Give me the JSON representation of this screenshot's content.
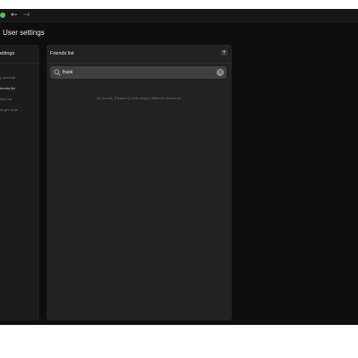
{
  "window": {
    "back_icon": "arrow-left-icon",
    "forward_icon": "arrow-right-icon",
    "status_color": "#58c05a"
  },
  "page": {
    "title": "User settings"
  },
  "sidebar": {
    "header": "ettings",
    "items": [
      {
        "label": "y account",
        "active": false
      },
      {
        "label": "riends list",
        "active": true
      },
      {
        "label": "lock list",
        "active": false
      },
      {
        "label": "anger zone",
        "active": false
      }
    ]
  },
  "panel": {
    "title": "Friends list",
    "add_icon": "plus-icon",
    "search": {
      "value": "frank",
      "search_icon": "search-icon",
      "clear_icon": "close-icon"
    },
    "empty_message": "No results. Please try searching a different username."
  },
  "colors": {
    "app_background": "#0e0e0e",
    "panel_background": "#222222",
    "search_background": "#404040"
  }
}
